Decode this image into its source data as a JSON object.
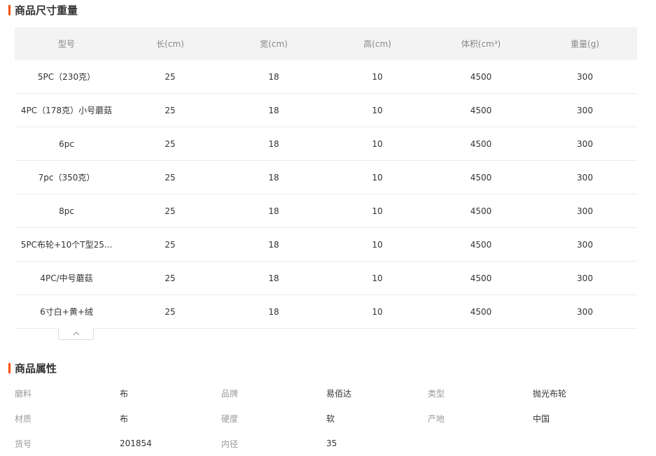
{
  "size_section": {
    "title": "商品尺寸重量",
    "headers": [
      "型号",
      "长(cm)",
      "宽(cm)",
      "高(cm)",
      "体积(cm³)",
      "重量(g)"
    ],
    "rows": [
      [
        "5PC（230克）",
        "25",
        "18",
        "10",
        "4500",
        "300"
      ],
      [
        "4PC（178克）小号蘑菇",
        "25",
        "18",
        "10",
        "4500",
        "300"
      ],
      [
        "6pc",
        "25",
        "18",
        "10",
        "4500",
        "300"
      ],
      [
        "7pc（350克）",
        "25",
        "18",
        "10",
        "4500",
        "300"
      ],
      [
        "8pc",
        "25",
        "18",
        "10",
        "4500",
        "300"
      ],
      [
        "5PC布轮+10个T型25...",
        "25",
        "18",
        "10",
        "4500",
        "300"
      ],
      [
        "4PC/中号蘑菇",
        "25",
        "18",
        "10",
        "4500",
        "300"
      ],
      [
        "6寸白+黄+绒",
        "25",
        "18",
        "10",
        "4500",
        "300"
      ]
    ],
    "collapse_icon": "chevron-up-icon"
  },
  "attr_section": {
    "title": "商品属性",
    "rows": [
      [
        {
          "label": "磨料",
          "value": "布"
        },
        {
          "label": "品牌",
          "value": "易佰达"
        },
        {
          "label": "类型",
          "value": "抛光布轮"
        }
      ],
      [
        {
          "label": "材质",
          "value": "布"
        },
        {
          "label": "硬度",
          "value": "软"
        },
        {
          "label": "产地",
          "value": "中国"
        }
      ],
      [
        {
          "label": "货号",
          "value": "201854"
        },
        {
          "label": "内径",
          "value": "35"
        }
      ]
    ]
  },
  "colors": {
    "accent": "#ff5000",
    "header_bg": "#f3f3f3",
    "border": "#ececec"
  }
}
